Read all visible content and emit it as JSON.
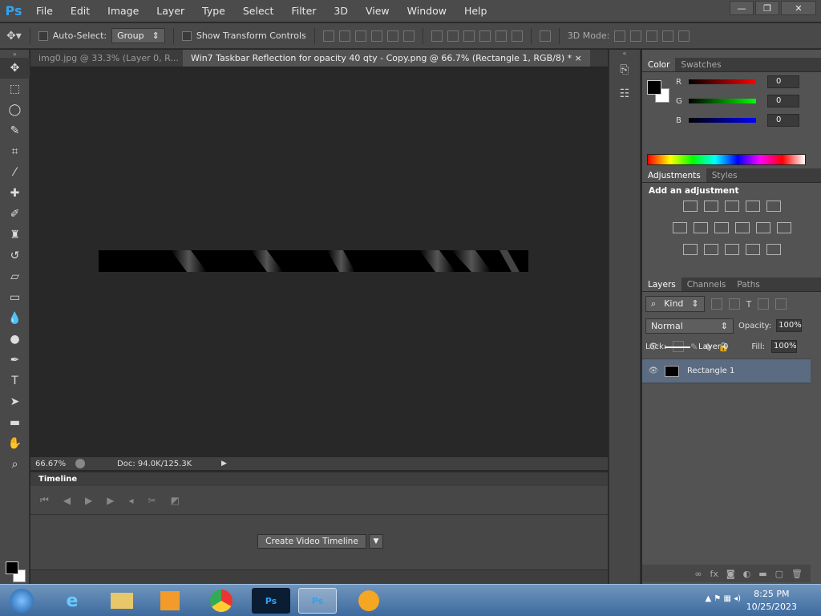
{
  "app": {
    "logo": "Ps"
  },
  "menu": [
    "File",
    "Edit",
    "Image",
    "Layer",
    "Type",
    "Select",
    "Filter",
    "3D",
    "View",
    "Window",
    "Help"
  ],
  "options": {
    "auto_select": "Auto-Select:",
    "group": "Group",
    "show_transform": "Show Transform Controls",
    "mode_3d": "3D Mode:"
  },
  "tabs": [
    {
      "label": "img0.jpg @ 33.3% (Layer 0, R...",
      "close": "×"
    },
    {
      "label": "Win7 Taskbar Reflection for opacity 40 qty  - Copy.png @ 66.7% (Rectangle 1, RGB/8) *",
      "close": "×"
    }
  ],
  "status": {
    "zoom": "66.67%",
    "doc": "Doc: 94.0K/125.3K"
  },
  "timeline": {
    "title": "Timeline",
    "create_btn": "Create Video Timeline"
  },
  "color_panel": {
    "tabs": [
      "Color",
      "Swatches"
    ],
    "r_label": "R",
    "g_label": "G",
    "b_label": "B",
    "r": "0",
    "g": "0",
    "b": "0"
  },
  "adjust_panel": {
    "tabs": [
      "Adjustments",
      "Styles"
    ],
    "heading": "Add an adjustment"
  },
  "layers_panel": {
    "tabs": [
      "Layers",
      "Channels",
      "Paths"
    ],
    "kind": "Kind",
    "blend": "Normal",
    "opacity_label": "Opacity:",
    "opacity": "100%",
    "lock_label": "Lock:",
    "fill_label": "Fill:",
    "fill": "100%",
    "layers": [
      {
        "name": "Layer 0"
      },
      {
        "name": "Rectangle 1"
      }
    ]
  },
  "taskbar": {
    "time": "8:25 PM",
    "date": "10/25/2023"
  }
}
